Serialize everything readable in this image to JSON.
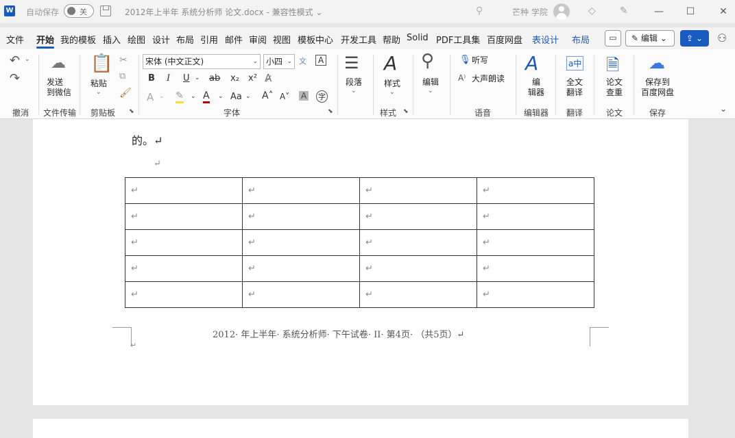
{
  "titlebar": {
    "app_logo": "W",
    "autosave_label": "自动保存",
    "autosave_toggle": "关",
    "doc_title": "2012年上半年 系统分析师 论文.docx  -  兼容性模式 ⌄",
    "user_name": "芒种 学院",
    "minimize": "—",
    "maximize": "☐",
    "close": "✕"
  },
  "menu": {
    "tabs": [
      "文件",
      "开始",
      "我的模板",
      "插入",
      "绘图",
      "设计",
      "布局",
      "引用",
      "邮件",
      "审阅",
      "视图",
      "模板中心",
      "开发工具",
      "帮助",
      "Solid",
      "PDF工具集",
      "百度网盘",
      "表设计",
      "布局"
    ],
    "active_tab": "开始",
    "edit_button": "编辑 ⌄",
    "share_button": "⇪ ⌄"
  },
  "ribbon": {
    "undo_group": "撤消",
    "file_transfer": {
      "button": [
        "发送",
        "到微信"
      ],
      "group": "文件传输"
    },
    "clipboard": {
      "paste": "粘贴",
      "group": "剪贴板"
    },
    "font": {
      "font_name": "宋体 (中文正文)",
      "font_size": "小四",
      "group": "字体",
      "bold": "B",
      "italic": "I",
      "underline": "U",
      "strike": "ab",
      "subscript": "x₂",
      "superscript": "x²",
      "font_color": "A",
      "change_case": "Aa",
      "grow": "A˄",
      "shrink": "A˅",
      "shade": "A",
      "phonetic": "字",
      "char_border": "A",
      "pinyin": "文"
    },
    "paragraph": {
      "button": "段落"
    },
    "styles": {
      "button": "样式",
      "group": "样式"
    },
    "editing": {
      "button": "编辑"
    },
    "voice": {
      "dictate": "听写",
      "read_aloud": "大声朗读",
      "group": "语音"
    },
    "editor": {
      "button": [
        "编",
        "辑器"
      ],
      "group": "编辑器"
    },
    "translate": {
      "button": [
        "全文",
        "翻译"
      ],
      "group": "翻译"
    },
    "thesis": {
      "button": [
        "论文",
        "查重"
      ],
      "group": "论文"
    },
    "save": {
      "button": [
        "保存到",
        "百度网盘"
      ],
      "group": "保存"
    },
    "collapse": "⌄"
  },
  "document": {
    "line1": "的。↵",
    "line2": "↵",
    "table": {
      "rows": [
        [
          "↵",
          "↵",
          "↵",
          "↵"
        ],
        [
          "↵",
          "↵",
          "↵",
          "↵"
        ],
        [
          "↵",
          "↵",
          "↵",
          "↵"
        ],
        [
          "↵",
          "↵",
          "↵",
          "↵"
        ],
        [
          "↵",
          "↵",
          "↵",
          "↵"
        ]
      ]
    },
    "footer": "2012· 年上半年· 系统分析师· 下午试卷· II· 第4页· （共5页）↵",
    "footer_mark": "↵"
  }
}
